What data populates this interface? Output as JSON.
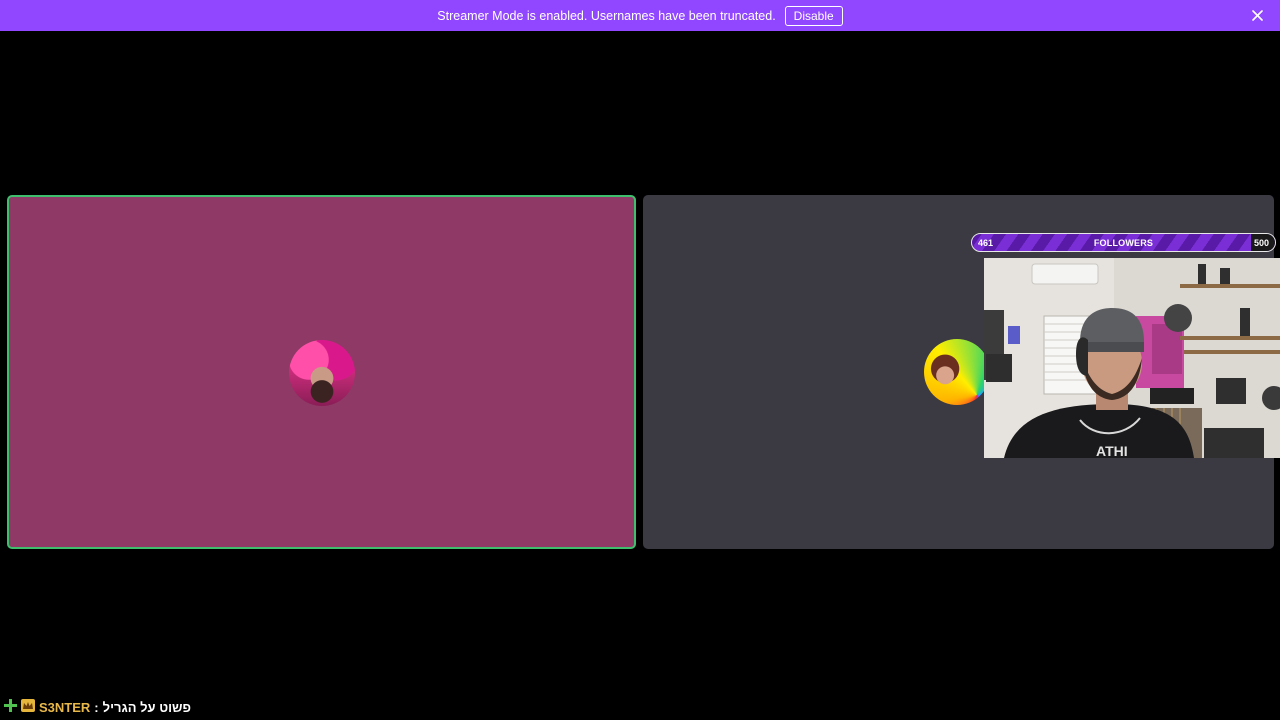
{
  "banner": {
    "message": "Streamer Mode is enabled. Usernames have been truncated.",
    "disable_label": "Disable",
    "close_icon": "close-icon",
    "background": "#9147ff"
  },
  "tiles": {
    "left": {
      "background": "#8e3966",
      "border": "#3fbf6e",
      "speaking": true
    },
    "right": {
      "background": "#3b3a42"
    }
  },
  "followers_goal": {
    "current": "461",
    "label": "FOLLOWERS",
    "goal": "500",
    "progress": 0.922
  },
  "chat": {
    "badges": [
      "plus-icon",
      "crown-badge-icon"
    ],
    "username": "S3NTER",
    "separator": ":",
    "message": "פשוט על הגריל"
  }
}
